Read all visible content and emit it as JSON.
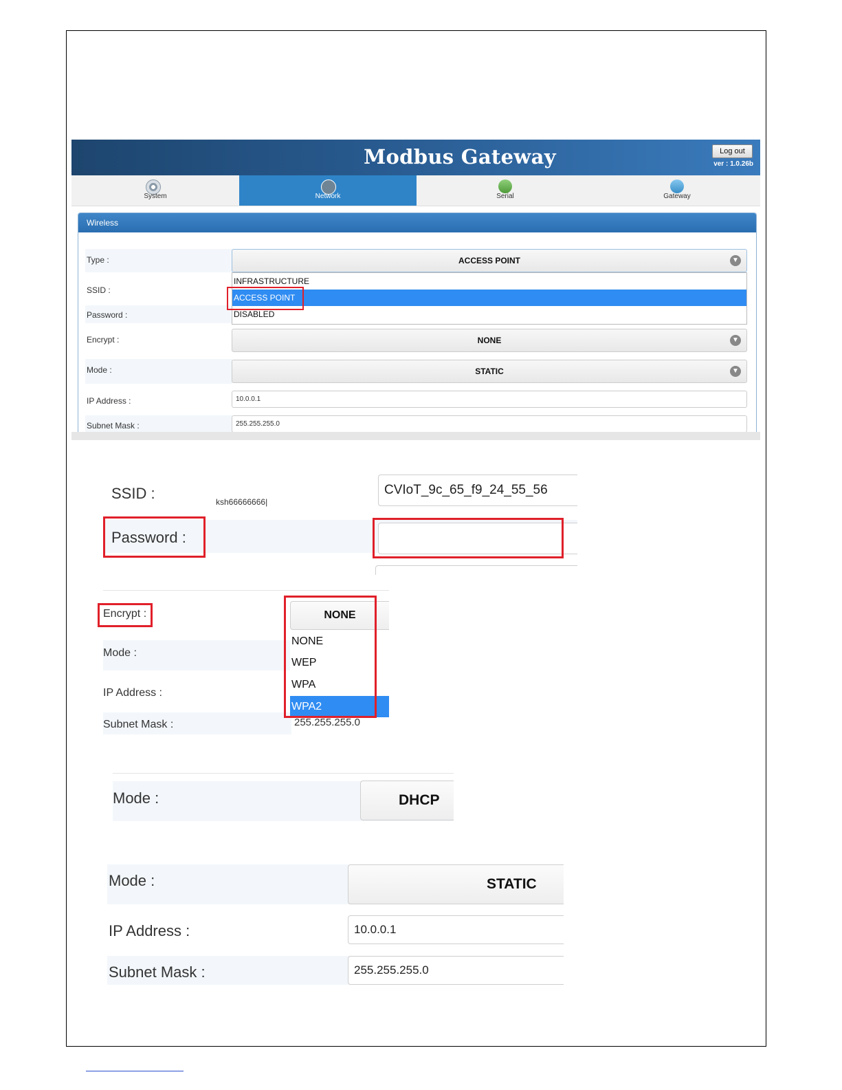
{
  "header": {
    "title": "Modbus Gateway",
    "logout_label": "Log out",
    "version": "ver : 1.0.26b"
  },
  "tabs": [
    {
      "label": "System",
      "icon": "gear-icon"
    },
    {
      "label": "Network",
      "icon": "network-icon"
    },
    {
      "label": "Serial",
      "icon": "serial-icon"
    },
    {
      "label": "Gateway",
      "icon": "gateway-icon"
    }
  ],
  "panel": {
    "title": "Wireless",
    "type_label": "Type :",
    "type_value": "ACCESS POINT",
    "type_options": [
      "INFRASTRUCTURE",
      "ACCESS POINT",
      "DISABLED"
    ],
    "ssid_label": "SSID :",
    "password_label": "Password :",
    "encrypt_label": "Encrypt :",
    "encrypt_value": "NONE",
    "mode_label": "Mode :",
    "mode_value": "STATIC",
    "ip_label": "IP Address :",
    "ip_value": "10.0.0.1",
    "subnet_label": "Subnet Mask :",
    "subnet_value": "255.255.255.0"
  },
  "crop_ssid": {
    "ssid_label": "SSID :",
    "ssid_note": "ksh66666666|",
    "ssid_value": "CVIoT_9c_65_f9_24_55_56",
    "password_label": "Password :",
    "password_value": ""
  },
  "crop_encrypt": {
    "encrypt_label": "Encrypt :",
    "encrypt_value": "NONE",
    "encrypt_options": [
      "NONE",
      "WEP",
      "WPA",
      "WPA2"
    ],
    "mode_label": "Mode :",
    "ip_label": "IP Address :",
    "subnet_label": "Subnet Mask :",
    "subnet_value": "255.255.255.0"
  },
  "crop_dhcp": {
    "mode_label": "Mode :",
    "mode_value": "DHCP"
  },
  "crop_static": {
    "mode_label": "Mode :",
    "mode_value": "STATIC",
    "ip_label": "IP Address :",
    "ip_value": "10.0.0.1",
    "subnet_label": "Subnet Mask :",
    "subnet_value": "255.255.255.0"
  },
  "colors": {
    "header_dark": "#1d456e",
    "accent": "#2f84c8",
    "selected": "#2f8cf2",
    "highlight_box": "#e0202a"
  }
}
